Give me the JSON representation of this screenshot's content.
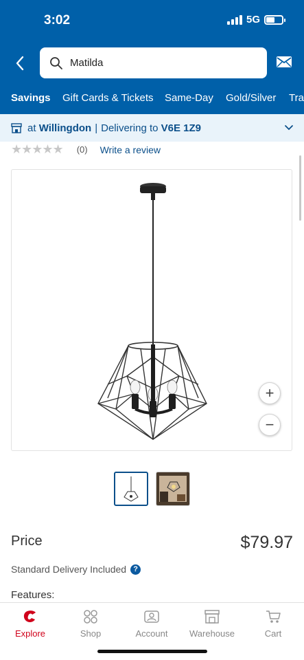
{
  "status_bar": {
    "time": "3:02",
    "network": "5G",
    "battery_level": 0.55
  },
  "search": {
    "query": "Matilda"
  },
  "icons": {
    "back": "chevron-left-icon",
    "search": "search-icon",
    "mail": "mail-icon",
    "store": "store-icon",
    "expand": "chevron-down-icon"
  },
  "nav": {
    "items": [
      {
        "label": "Savings",
        "active": true
      },
      {
        "label": "Gift Cards & Tickets"
      },
      {
        "label": "Same-Day"
      },
      {
        "label": "Gold/Silver"
      },
      {
        "label": "Trav"
      }
    ]
  },
  "location": {
    "prefix": "at",
    "store": "Willingdon",
    "separator": "|",
    "delivering_label": "Delivering to",
    "postal_code": "V6E 1Z9"
  },
  "rating": {
    "stars": "★★★★★",
    "stars_value": 0,
    "count": "(0)",
    "write_review": "Write a review"
  },
  "product": {
    "zoom_in_label": "+",
    "zoom_out_label": "−",
    "thumbnails": [
      "product-image",
      "lifestyle-image"
    ],
    "price_label": "Price",
    "price": "$79.97",
    "delivery_text": "Standard Delivery Included",
    "info_label": "?",
    "features_label": "Features:"
  },
  "tabbar": {
    "items": [
      {
        "label": "Explore",
        "icon": "costco-logo-icon",
        "active": true
      },
      {
        "label": "Shop",
        "icon": "grid-icon"
      },
      {
        "label": "Account",
        "icon": "account-icon"
      },
      {
        "label": "Warehouse",
        "icon": "warehouse-icon"
      },
      {
        "label": "Cart",
        "icon": "cart-icon"
      }
    ]
  },
  "colors": {
    "header_blue": "#0060a9",
    "link_blue": "#0b4f8a",
    "location_bg": "#e9f3fa",
    "accent_red": "#d0021b"
  }
}
